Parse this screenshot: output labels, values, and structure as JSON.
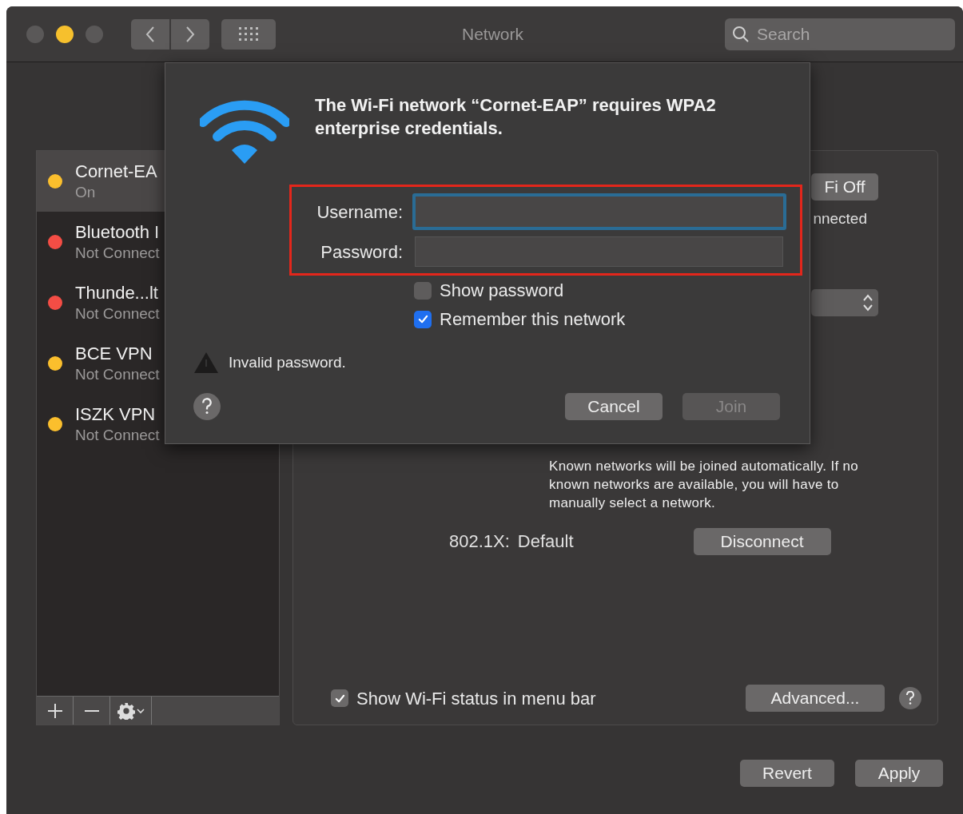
{
  "window": {
    "title": "Network",
    "search": {
      "placeholder": "Search"
    }
  },
  "sidebar": {
    "items": [
      {
        "name": "Cornet-EA",
        "status": "On",
        "color": "#fbbf2d",
        "selected": true
      },
      {
        "name": "Bluetooth I",
        "status": "Not Connect",
        "color": "#f44d45",
        "selected": false
      },
      {
        "name": "Thunde...lt",
        "status": "Not Connect",
        "color": "#f44d45",
        "selected": false
      },
      {
        "name": "BCE VPN",
        "status": "Not Connect",
        "color": "#fbbf2d",
        "selected": false
      },
      {
        "name": "ISZK VPN",
        "status": "Not Connect",
        "color": "#fbbf2d",
        "selected": false
      }
    ]
  },
  "panel": {
    "wifi_button": "Fi Off",
    "status": "nnected",
    "note": "Known networks will be joined automatically. If no known networks are available, you will have to manually select a network.",
    "security_label": "802.1X:",
    "security_value": "Default",
    "disconnect": "Disconnect",
    "show_status": {
      "label": "Show Wi-Fi status in menu bar",
      "checked": true
    },
    "advanced": "Advanced..."
  },
  "footer": {
    "revert": "Revert",
    "apply": "Apply"
  },
  "dialog": {
    "title": "The Wi-Fi network “Cornet-EAP” requires WPA2 enterprise credentials.",
    "username_label": "Username:",
    "password_label": "Password:",
    "show_password": {
      "label": "Show password",
      "checked": false
    },
    "remember": {
      "label": "Remember this network",
      "checked": true
    },
    "error": "Invalid password.",
    "cancel": "Cancel",
    "join": {
      "label": "Join",
      "disabled": true
    }
  }
}
